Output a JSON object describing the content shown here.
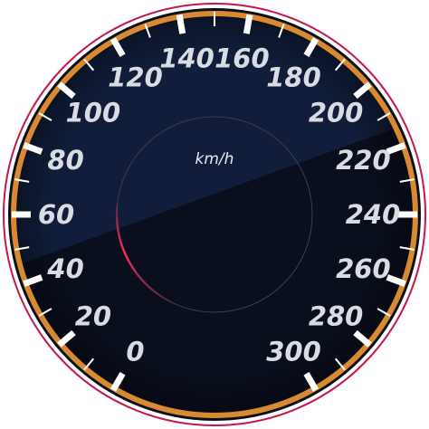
{
  "gauge": {
    "unit": "km/h",
    "min": 0,
    "max": 300,
    "major_step": 20,
    "minor_step": 10,
    "current_value": 0,
    "start_angle_deg": 240,
    "end_angle_deg": -60,
    "labels": [
      "0",
      "20",
      "40",
      "60",
      "80",
      "100",
      "120",
      "140",
      "160",
      "180",
      "200",
      "220",
      "240",
      "260",
      "280",
      "300"
    ],
    "colors": {
      "face": "#0a0f1e",
      "face_sheen": "#13203f",
      "outer_ring": "#c2174f",
      "scale_ring": "#d98a30",
      "ticks": "#ffffff",
      "labels": "#d9dce3",
      "inner_glow": "#ff2a5a"
    }
  }
}
